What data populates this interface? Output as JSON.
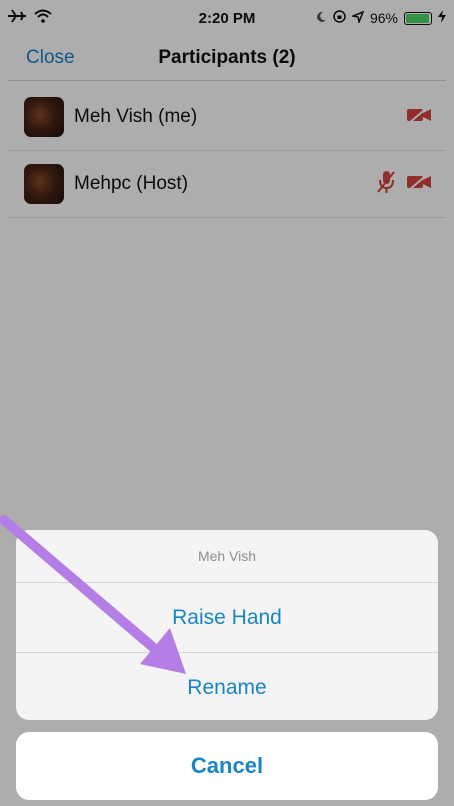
{
  "status_bar": {
    "time": "2:20 PM",
    "battery_text": "96%",
    "icons": [
      "airplane-icon",
      "wifi-icon",
      "moon-icon",
      "orientation-lock-icon",
      "location-icon",
      "battery-icon",
      "charging-icon"
    ]
  },
  "nav": {
    "close_label": "Close",
    "title": "Participants (2)"
  },
  "participants": [
    {
      "name": "Meh Vish (me)",
      "mic_muted": false,
      "video_off": true
    },
    {
      "name": "Mehpc (Host)",
      "mic_muted": true,
      "video_off": true
    }
  ],
  "action_sheet": {
    "title": "Meh Vish",
    "buttons": [
      "Raise Hand",
      "Rename"
    ],
    "cancel_label": "Cancel"
  },
  "colors": {
    "accent": "#1a84c9",
    "muted_red": "#d64541",
    "annotation_arrow": "#b57ee6"
  }
}
